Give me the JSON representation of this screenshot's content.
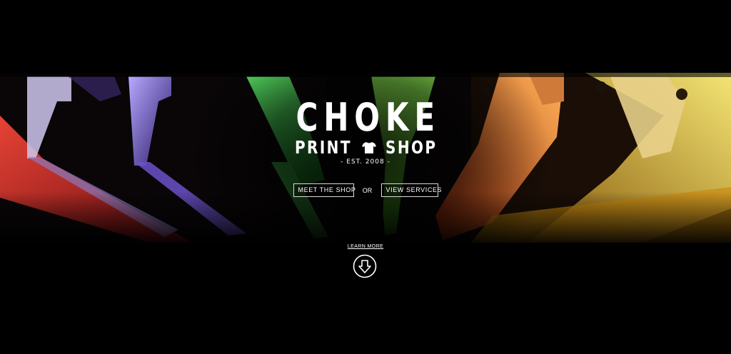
{
  "hero": {
    "image_name": "squeegees-artwork"
  },
  "logo": {
    "title": "CHOKE",
    "print_word": "PRINT",
    "shop_word": "SHOP",
    "est": "- EST. 2008 -",
    "icon": "tshirt-icon"
  },
  "cta": {
    "meet_label": "MEET THE SHOP",
    "or_label": "OR",
    "services_label": "VIEW SERVICES"
  },
  "learn_more": {
    "label": "LEARN MORE",
    "icon": "arrow-down-circle-icon"
  },
  "colors": {
    "background": "#000000",
    "text": "#ffffff",
    "squeegee_red": "#e0302a",
    "squeegee_purple": "#7a5ad8",
    "squeegee_green": "#3fc24a",
    "squeegee_orange": "#e8601a",
    "squeegee_yellow": "#e8c21a"
  }
}
